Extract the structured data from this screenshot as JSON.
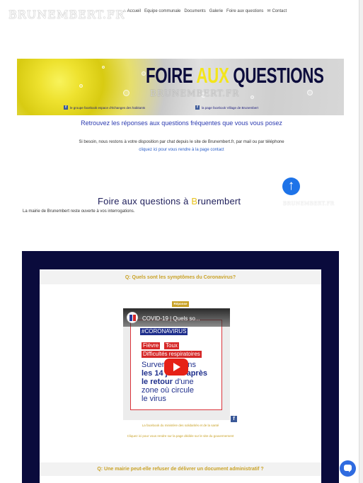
{
  "site": {
    "logo": "BRUNEMBERT.FR"
  },
  "nav": {
    "items": [
      {
        "label": "Accueil",
        "icon": "home-icon"
      },
      {
        "label": "Equipe communale"
      },
      {
        "label": "Documents"
      },
      {
        "label": "Galerie"
      },
      {
        "label": "Foire aux questions"
      },
      {
        "label": "Contact",
        "icon": "envelope-icon"
      }
    ]
  },
  "banner": {
    "title_part1": "FOIRE ",
    "title_part2": "AUX",
    "title_part3": " QUESTIONS",
    "watermark": "BRUNEMBERT.FR",
    "caption_left": "le groupe facebook espace d'échanges des habitants",
    "caption_right": "la page facebook Village de Brunembert"
  },
  "intro": {
    "heading": "Retrouvez les réponses aux questions fréquentes que vous vous posez",
    "text": "Si besoin, nous restons à votre disposition par chat depuis le site de Brunembert.fr, par mail ou par téléphone",
    "link": "cliquez ici pour vous rendre à la page contact"
  },
  "section": {
    "heading_part1": "Foire aux questions à ",
    "heading_part2": "B",
    "heading_part3": "runembert",
    "watermark": "BRUNEMBERT.FR",
    "subtext": "La mairie de Brunembert reste ouverte à vos interrogations."
  },
  "faq": {
    "q1": "Q: Quels sont les symptômes du Coronavirus?",
    "answer_badge": "Réponse",
    "video": {
      "title": "COVID-19 | Quels so...",
      "hashtag": "#CORONAVIRUS",
      "tag1": "Fièvre",
      "tag2": "Toux",
      "tag3": "Difficultés respiratoires",
      "line1": "Survenant dans",
      "line2": "les 14 jours après",
      "line3_bold": "le retour",
      "line3_rest": " d'une",
      "line4": "zone où circule",
      "line5": "le virus"
    },
    "link1": "La facebook du ministère des solidarités et de la santé",
    "link2": "Cliquez ici pour vous rendre sur la page dédiée sur le site du gouvernement",
    "q2": "Q: Une mairie peut-elle refuser de délivrer un document administratif ?"
  },
  "colors": {
    "accent_blue": "#2b3ab0",
    "gold": "#c9a227",
    "dark_navy": "#0a0b3c",
    "chat_blue": "#2f6be0"
  }
}
